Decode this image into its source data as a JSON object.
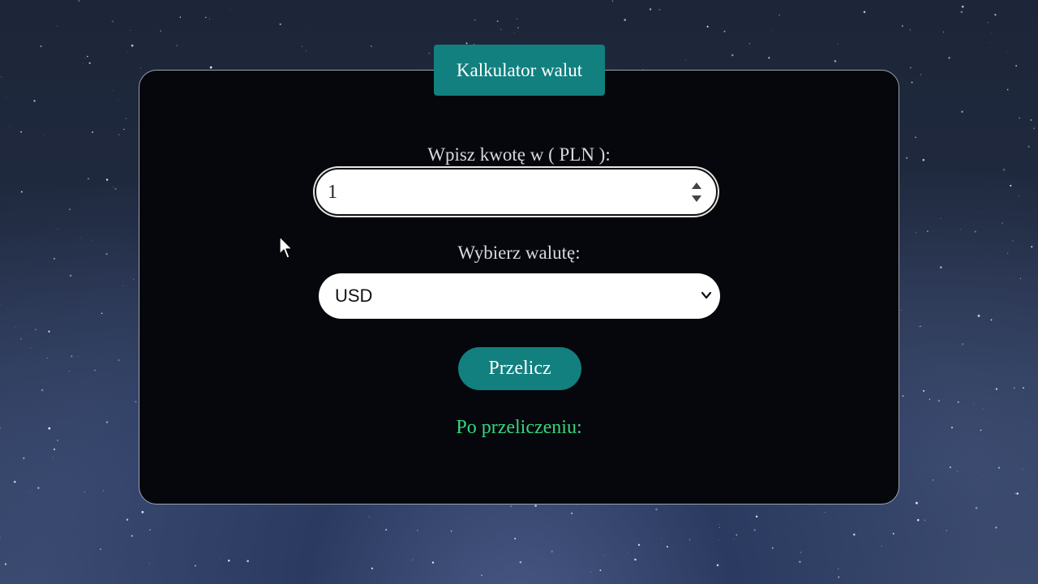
{
  "app": {
    "title": "Kalkulator walut"
  },
  "form": {
    "amount_label": "Wpisz kwotę w ( PLN ):",
    "amount_value": "1",
    "currency_label": "Wybierz walutę:",
    "currency_selected": "USD",
    "convert_button": "Przelicz",
    "result_label": "Po przeliczeniu:"
  },
  "icons": {
    "spinner": "number-spinner-icon",
    "dropdown": "chevron-down-icon",
    "pointer": "mouse-cursor-icon"
  },
  "colors": {
    "accent": "#11807f",
    "result_text": "#37d67e",
    "panel_bg": "#05070c"
  }
}
